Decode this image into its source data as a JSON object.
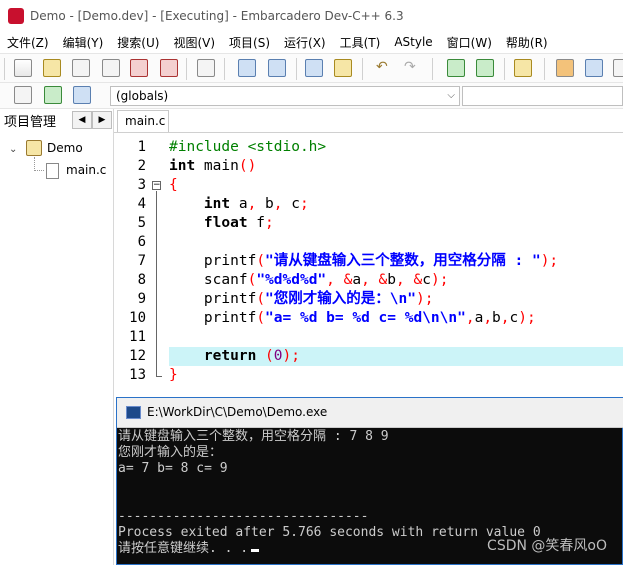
{
  "window": {
    "title": "Demo - [Demo.dev] - [Executing] - Embarcadero Dev-C++ 6.3",
    "icon_text": "DEV C++"
  },
  "menu": [
    "文件(Z)",
    "编辑(Y)",
    "搜索(U)",
    "视图(V)",
    "项目(S)",
    "运行(X)",
    "工具(T)",
    "AStyle",
    "窗口(W)",
    "帮助(R)"
  ],
  "toolbar": {
    "globals_value": "(globals)"
  },
  "project_panel": {
    "tab_label": "项目管理",
    "tree": {
      "project": "Demo",
      "file": "main.c"
    }
  },
  "editor": {
    "tab_label": "main.c",
    "line_numbers": [
      "1",
      "2",
      "3",
      "4",
      "5",
      "6",
      "7",
      "8",
      "9",
      "10",
      "11",
      "12",
      "13"
    ],
    "lines": [
      [
        {
          "c": "pp",
          "t": "#include <stdio.h>"
        }
      ],
      [
        {
          "c": "kw",
          "t": "int"
        },
        {
          "c": "id",
          "t": " main"
        },
        {
          "c": "sym",
          "t": "()"
        }
      ],
      [
        {
          "c": "sym",
          "t": "{"
        }
      ],
      [
        {
          "c": "id",
          "t": "    "
        },
        {
          "c": "kw",
          "t": "int"
        },
        {
          "c": "id",
          "t": " a"
        },
        {
          "c": "sym",
          "t": ","
        },
        {
          "c": "id",
          "t": " b"
        },
        {
          "c": "sym",
          "t": ","
        },
        {
          "c": "id",
          "t": " c"
        },
        {
          "c": "sym",
          "t": ";"
        }
      ],
      [
        {
          "c": "id",
          "t": "    "
        },
        {
          "c": "kw",
          "t": "float"
        },
        {
          "c": "id",
          "t": " f"
        },
        {
          "c": "sym",
          "t": ";"
        }
      ],
      [],
      [
        {
          "c": "id",
          "t": "    printf"
        },
        {
          "c": "sym",
          "t": "("
        },
        {
          "c": "str",
          "t": "\"请从键盘输入三个整数，用空格分隔 : \""
        },
        {
          "c": "sym",
          "t": ");"
        }
      ],
      [
        {
          "c": "id",
          "t": "    scanf"
        },
        {
          "c": "sym",
          "t": "("
        },
        {
          "c": "str",
          "t": "\"%d%d%d\""
        },
        {
          "c": "sym",
          "t": ", &"
        },
        {
          "c": "id",
          "t": "a"
        },
        {
          "c": "sym",
          "t": ", &"
        },
        {
          "c": "id",
          "t": "b"
        },
        {
          "c": "sym",
          "t": ", &"
        },
        {
          "c": "id",
          "t": "c"
        },
        {
          "c": "sym",
          "t": ");"
        }
      ],
      [
        {
          "c": "id",
          "t": "    printf"
        },
        {
          "c": "sym",
          "t": "("
        },
        {
          "c": "str",
          "t": "\"您刚才输入的是：\\n\""
        },
        {
          "c": "sym",
          "t": ");"
        }
      ],
      [
        {
          "c": "id",
          "t": "    printf"
        },
        {
          "c": "sym",
          "t": "("
        },
        {
          "c": "str",
          "t": "\"a= %d b= %d c= %d\\n\\n\""
        },
        {
          "c": "sym",
          "t": ","
        },
        {
          "c": "id",
          "t": "a"
        },
        {
          "c": "sym",
          "t": ","
        },
        {
          "c": "id",
          "t": "b"
        },
        {
          "c": "sym",
          "t": ","
        },
        {
          "c": "id",
          "t": "c"
        },
        {
          "c": "sym",
          "t": ");"
        }
      ],
      [],
      [
        {
          "c": "id",
          "t": "    "
        },
        {
          "c": "kw",
          "t": "return"
        },
        {
          "c": "id",
          "t": " "
        },
        {
          "c": "sym",
          "t": "("
        },
        {
          "c": "num",
          "t": "0"
        },
        {
          "c": "sym",
          "t": ");"
        }
      ],
      [
        {
          "c": "sym",
          "t": "}"
        }
      ]
    ],
    "highlighted_line": 12
  },
  "console": {
    "title": "E:\\WorkDir\\C\\Demo\\Demo.exe",
    "lines": [
      "请从键盘输入三个整数，用空格分隔 : 7 8 9",
      "您刚才输入的是：",
      "a= 7 b= 8 c= 9",
      "",
      "",
      "--------------------------------",
      "Process exited after 5.766 seconds with return value 0",
      "请按任意键继续. . ."
    ]
  },
  "watermark": "CSDN @笑春风oO"
}
